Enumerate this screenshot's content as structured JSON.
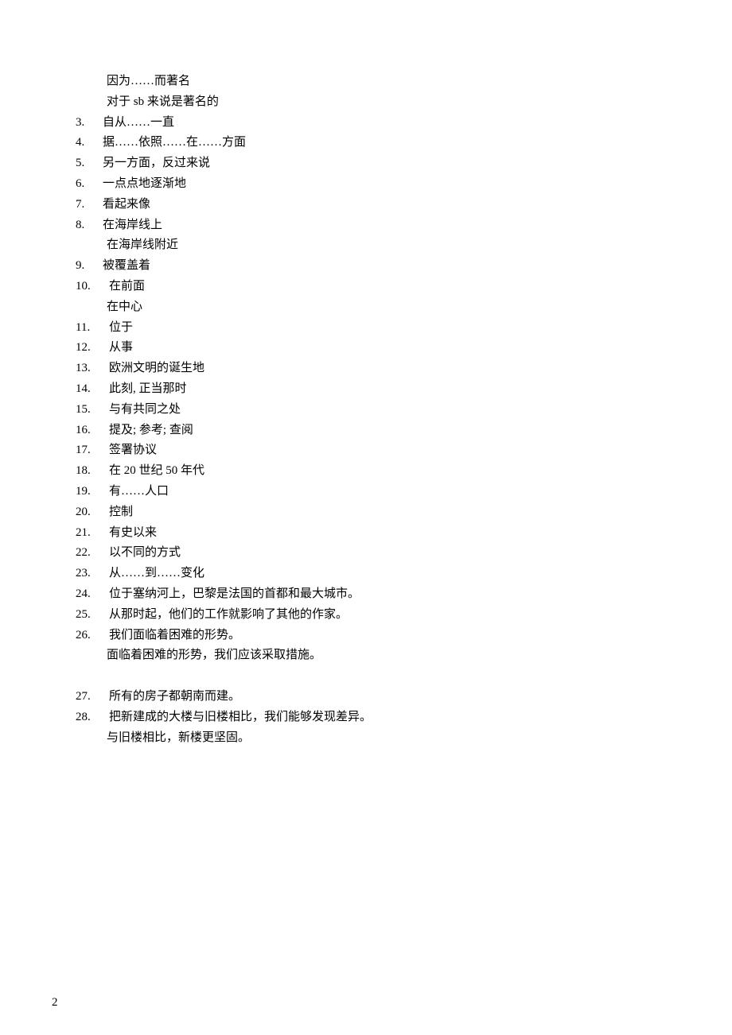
{
  "lines": [
    {
      "indent": true,
      "num": "",
      "text": "因为……而著名"
    },
    {
      "indent": true,
      "num": "",
      "text": "对于 sb 来说是著名的"
    },
    {
      "indent": false,
      "num": "3.",
      "text": "自从……一直"
    },
    {
      "indent": false,
      "num": "4.",
      "text": "据……依照……在……方面"
    },
    {
      "indent": false,
      "num": "5.",
      "text": "另一方面，反过来说"
    },
    {
      "indent": false,
      "num": "6.",
      "text": "一点点地逐渐地"
    },
    {
      "indent": false,
      "num": "7.",
      "text": "看起来像"
    },
    {
      "indent": false,
      "num": "8.",
      "text": "在海岸线上"
    },
    {
      "indent": true,
      "num": "",
      "text": "在海岸线附近"
    },
    {
      "indent": false,
      "num": "9.",
      "text": "被覆盖着"
    },
    {
      "indent": false,
      "num": "10.",
      "text": "在前面"
    },
    {
      "indent": true,
      "num": "",
      "text": "在中心"
    },
    {
      "indent": false,
      "num": "11.",
      "text": "位于"
    },
    {
      "indent": false,
      "num": "12.",
      "text": "从事"
    },
    {
      "indent": false,
      "num": "13.",
      "text": "欧洲文明的诞生地"
    },
    {
      "indent": false,
      "num": "14.",
      "text": "此刻, 正当那时"
    },
    {
      "indent": false,
      "num": "15.",
      "text": "与有共同之处"
    },
    {
      "indent": false,
      "num": "16.",
      "text": "提及;  参考;  查阅"
    },
    {
      "indent": false,
      "num": "17.",
      "text": "签署协议"
    },
    {
      "indent": false,
      "num": "18.",
      "text": "在 20 世纪 50 年代"
    },
    {
      "indent": false,
      "num": "19.",
      "text": "有……人口"
    },
    {
      "indent": false,
      "num": "20.",
      "text": "控制"
    },
    {
      "indent": false,
      "num": "21.",
      "text": "有史以来"
    },
    {
      "indent": false,
      "num": "22.",
      "text": "以不同的方式"
    },
    {
      "indent": false,
      "num": "23.",
      "text": "从……到……变化"
    },
    {
      "indent": false,
      "num": "24.",
      "text": "位于塞纳河上，巴黎是法国的首都和最大城市。"
    },
    {
      "indent": false,
      "num": "25.",
      "text": "从那时起，他们的工作就影响了其他的作家。"
    },
    {
      "indent": false,
      "num": "26.",
      "text": "我们面临着困难的形势。"
    },
    {
      "indent": true,
      "num": "",
      "text": "面临着困难的形势，我们应该采取措施。"
    },
    {
      "spacer": true
    },
    {
      "indent": false,
      "num": "27.",
      "text": "所有的房子都朝南而建。"
    },
    {
      "indent": false,
      "num": "28.",
      "text": "把新建成的大楼与旧楼相比，我们能够发现差异。"
    },
    {
      "indent": true,
      "num": "",
      "text": "与旧楼相比，新楼更坚固。"
    }
  ],
  "pageNumber": "2"
}
